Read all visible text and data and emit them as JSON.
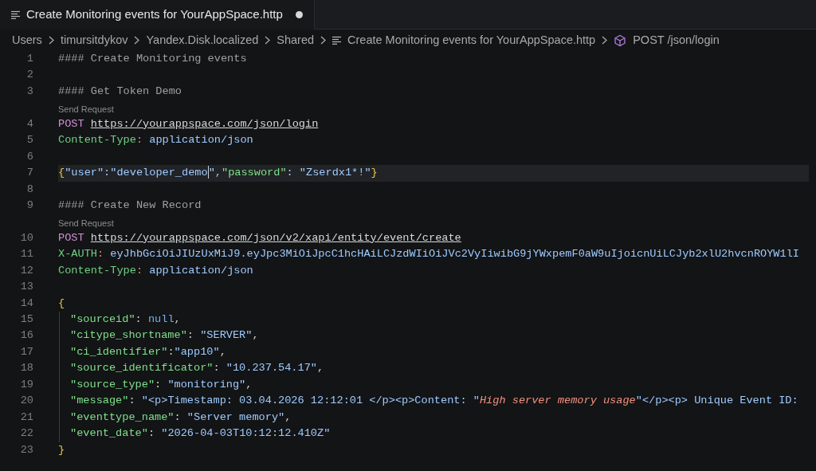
{
  "tab": {
    "title": "Create Monitoring events for YourAppSpace.http",
    "modified": true
  },
  "breadcrumbs": [
    {
      "kind": "folder",
      "text": "Users"
    },
    {
      "kind": "folder",
      "text": "timursitdykov"
    },
    {
      "kind": "folder",
      "text": "Yandex.Disk.localized"
    },
    {
      "kind": "folder",
      "text": "Shared"
    },
    {
      "kind": "file",
      "text": "Create Monitoring events for YourAppSpace.http"
    },
    {
      "kind": "symbol",
      "text": "POST /json/login"
    }
  ],
  "lines": [
    {
      "number": "1",
      "current": false,
      "tokens": [
        {
          "kind": "comment",
          "text": "#### Create Monitoring events"
        }
      ]
    },
    {
      "number": "2",
      "current": false
    },
    {
      "number": "3",
      "current": false,
      "tokens": [
        {
          "kind": "comment",
          "text": "#### Get Token Demo"
        }
      ]
    },
    {
      "number": "4",
      "current": false,
      "codelens": "Send Request",
      "tokens": [
        {
          "kind": "method",
          "text": "POST "
        },
        {
          "kind": "url",
          "text": "https://yourappspace.com/json/login"
        }
      ]
    },
    {
      "number": "5",
      "current": false,
      "tokens": [
        {
          "kind": "header",
          "text": "Content-Type"
        },
        {
          "kind": "colon",
          "text": ":"
        },
        {
          "kind": "value",
          "text": " application/json"
        }
      ]
    },
    {
      "number": "6",
      "current": false
    },
    {
      "number": "7",
      "current": true,
      "tokens": [
        {
          "kind": "brace",
          "text": "{"
        },
        {
          "kind": "value",
          "text": "\"user\":\"developer_demo"
        },
        {
          "kind": "cursor"
        },
        {
          "kind": "value",
          "text": "\","
        },
        {
          "kind": "key",
          "text": "\"password\""
        },
        {
          "kind": "value",
          "text": ": \"Zserdx1*!\""
        },
        {
          "kind": "brace",
          "text": "}"
        }
      ]
    },
    {
      "number": "8",
      "current": false
    },
    {
      "number": "9",
      "current": false,
      "tokens": [
        {
          "kind": "comment",
          "text": "#### Create New Record"
        }
      ]
    },
    {
      "number": "10",
      "current": false,
      "codelens": "Send Request",
      "tokens": [
        {
          "kind": "method",
          "text": "POST "
        },
        {
          "kind": "url",
          "text": "https://yourappspace.com/json/v2/xapi/entity/event/create"
        }
      ]
    },
    {
      "number": "11",
      "current": false,
      "tokens": [
        {
          "kind": "header",
          "text": "X-AUTH"
        },
        {
          "kind": "colon",
          "text": ":"
        },
        {
          "kind": "value",
          "text": " eyJhbGciOiJIUzUxMiJ9.eyJpc3MiOiJpcC1hcHAiLCJzdWIiOiJVc2VyIiwibG9jYWxpemF0aW9uIjoicnUiLCJyb2xlU2hvcnROYW1lI"
        }
      ]
    },
    {
      "number": "12",
      "current": false,
      "tokens": [
        {
          "kind": "header",
          "text": "Content-Type"
        },
        {
          "kind": "colon",
          "text": ":"
        },
        {
          "kind": "value",
          "text": " application/json"
        }
      ]
    },
    {
      "number": "13",
      "current": false
    },
    {
      "number": "14",
      "current": false,
      "tokens": [
        {
          "kind": "brace",
          "text": "{"
        }
      ]
    },
    {
      "number": "15",
      "current": false,
      "indent": true,
      "tokens": [
        {
          "kind": "key",
          "text": "\"sourceid\""
        },
        {
          "kind": "plain",
          "text": ": "
        },
        {
          "kind": "null",
          "text": "null"
        },
        {
          "kind": "plain",
          "text": ","
        }
      ]
    },
    {
      "number": "16",
      "current": false,
      "indent": true,
      "tokens": [
        {
          "kind": "key",
          "text": "\"citype_shortname\""
        },
        {
          "kind": "plain",
          "text": ": "
        },
        {
          "kind": "value",
          "text": "\"SERVER\""
        },
        {
          "kind": "plain",
          "text": ","
        }
      ]
    },
    {
      "number": "17",
      "current": false,
      "indent": true,
      "tokens": [
        {
          "kind": "key",
          "text": "\"ci_identifier\""
        },
        {
          "kind": "plain",
          "text": ":"
        },
        {
          "kind": "value",
          "text": "\"app10\""
        },
        {
          "kind": "plain",
          "text": ","
        }
      ]
    },
    {
      "number": "18",
      "current": false,
      "indent": true,
      "tokens": [
        {
          "kind": "key",
          "text": "\"source_identificator\""
        },
        {
          "kind": "plain",
          "text": ": "
        },
        {
          "kind": "value",
          "text": "\"10.237.54.17\""
        },
        {
          "kind": "plain",
          "text": ","
        }
      ]
    },
    {
      "number": "19",
      "current": false,
      "indent": true,
      "tokens": [
        {
          "kind": "key",
          "text": "\"source_type\""
        },
        {
          "kind": "plain",
          "text": ": "
        },
        {
          "kind": "value",
          "text": "\"monitoring\""
        },
        {
          "kind": "plain",
          "text": ","
        }
      ]
    },
    {
      "number": "20",
      "current": false,
      "indent": true,
      "tokens": [
        {
          "kind": "key",
          "text": "\"message\""
        },
        {
          "kind": "plain",
          "text": ": "
        },
        {
          "kind": "value",
          "text": "\"<p>Timestamp: 03.04.2026 12:12:01 </p><p>Content: \""
        },
        {
          "kind": "emphasis",
          "text": "High server memory usage"
        },
        {
          "kind": "value",
          "text": "\"</p><p> Unique Event ID:"
        }
      ]
    },
    {
      "number": "21",
      "current": false,
      "indent": true,
      "tokens": [
        {
          "kind": "key",
          "text": "\"eventtype_name\""
        },
        {
          "kind": "plain",
          "text": ": "
        },
        {
          "kind": "value",
          "text": "\"Server memory\""
        },
        {
          "kind": "plain",
          "text": ","
        }
      ]
    },
    {
      "number": "22",
      "current": false,
      "indent": true,
      "tokens": [
        {
          "kind": "key",
          "text": "\"event_date\""
        },
        {
          "kind": "plain",
          "text": ": "
        },
        {
          "kind": "value",
          "text": "\"2026-04-03T10:12:12.410Z\""
        }
      ]
    },
    {
      "number": "23",
      "current": false,
      "tokens": [
        {
          "kind": "brace",
          "text": "}"
        }
      ]
    }
  ]
}
